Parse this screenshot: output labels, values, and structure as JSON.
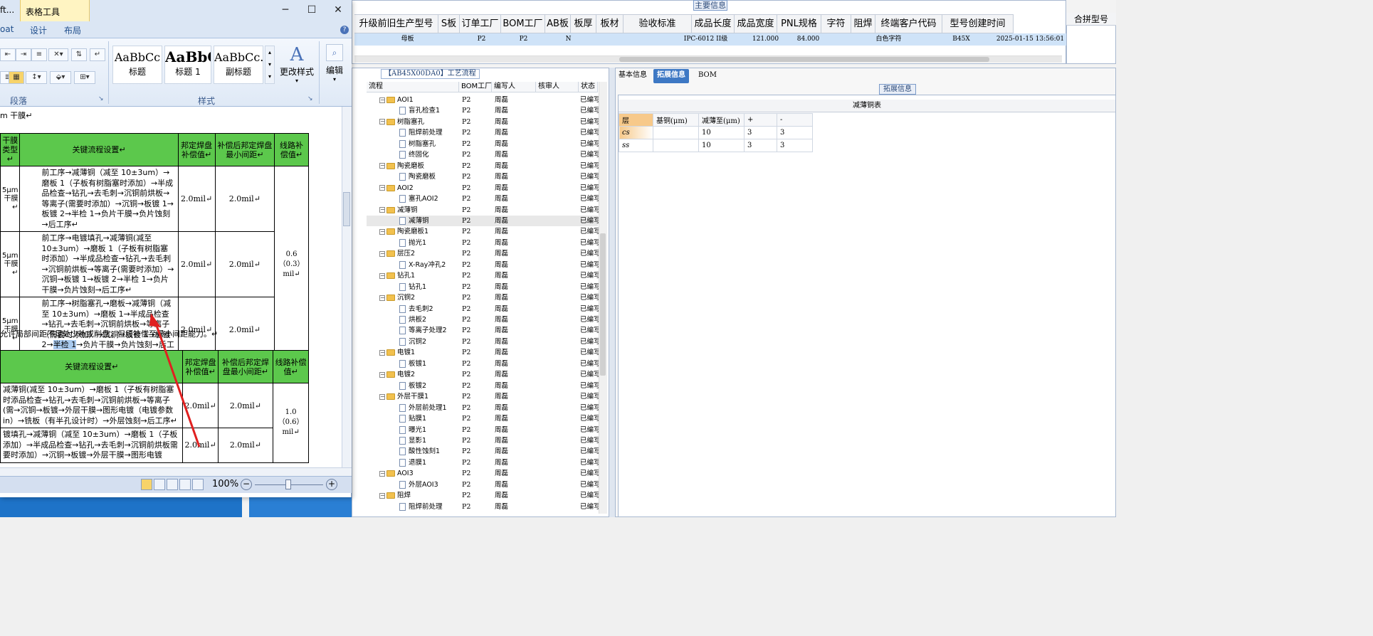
{
  "top_grid": {
    "section_label": "主要信息",
    "headers": [
      "升级前旧生产型号",
      "S板",
      "订单工厂",
      "BOM工厂",
      "AB板",
      "板厚",
      "板材",
      "验收标准",
      "成品长度",
      "成品宽度",
      "PNL规格",
      "字符",
      "阻焊",
      "终端客户代码",
      "型号创建时间"
    ],
    "row": [
      "母板",
      "P2",
      "P2",
      "N",
      "",
      "",
      "IPC-6012 II级",
      "121.000",
      "84.000",
      "",
      "白色字符",
      "",
      "B45X",
      "2025-01-15 13:56:01"
    ],
    "merge_header": "合拼型号"
  },
  "flow": {
    "title": "【AB45X00DA0】工艺流程",
    "headers": [
      "流程",
      "BOM工厂",
      "编写人",
      "核审人",
      "状态"
    ],
    "rows": [
      {
        "name": "AOI1",
        "type": "folder",
        "bom": "P2",
        "writer": "周磊",
        "status": "已编写"
      },
      {
        "name": "盲孔检查1",
        "type": "file",
        "bom": "P2",
        "writer": "周磊",
        "status": "已编写"
      },
      {
        "name": "树脂塞孔",
        "type": "folder",
        "bom": "P2",
        "writer": "周磊",
        "status": "已编写"
      },
      {
        "name": "阻焊前处理",
        "type": "file",
        "bom": "P2",
        "writer": "周磊",
        "status": "已编写"
      },
      {
        "name": "树脂塞孔",
        "type": "file",
        "bom": "P2",
        "writer": "周磊",
        "status": "已编写"
      },
      {
        "name": "终固化",
        "type": "file",
        "bom": "P2",
        "writer": "周磊",
        "status": "已编写"
      },
      {
        "name": "陶瓷磨板",
        "type": "folder",
        "bom": "P2",
        "writer": "周磊",
        "status": "已编写"
      },
      {
        "name": "陶瓷磨板",
        "type": "file",
        "bom": "P2",
        "writer": "周磊",
        "status": "已编写"
      },
      {
        "name": "AOI2",
        "type": "folder",
        "bom": "P2",
        "writer": "周磊",
        "status": "已编写"
      },
      {
        "name": "塞孔AOI2",
        "type": "file",
        "bom": "P2",
        "writer": "周磊",
        "status": "已编写"
      },
      {
        "name": "减薄铜",
        "type": "folder",
        "bom": "P2",
        "writer": "周磊",
        "status": "已编写"
      },
      {
        "name": "减薄铜",
        "type": "file",
        "bom": "P2",
        "writer": "周磊",
        "status": "已编写",
        "selected": true
      },
      {
        "name": "陶瓷磨板1",
        "type": "folder",
        "bom": "P2",
        "writer": "周磊",
        "status": "已编写"
      },
      {
        "name": "抛光1",
        "type": "file",
        "bom": "P2",
        "writer": "周磊",
        "status": "已编写"
      },
      {
        "name": "层压2",
        "type": "folder",
        "bom": "P2",
        "writer": "周磊",
        "status": "已编写"
      },
      {
        "name": "X-Ray冲孔2",
        "type": "file",
        "bom": "P2",
        "writer": "周磊",
        "status": "已编写"
      },
      {
        "name": "钻孔1",
        "type": "folder",
        "bom": "P2",
        "writer": "周磊",
        "status": "已编写"
      },
      {
        "name": "钻孔1",
        "type": "file",
        "bom": "P2",
        "writer": "周磊",
        "status": "已编写"
      },
      {
        "name": "沉铜2",
        "type": "folder",
        "bom": "P2",
        "writer": "周磊",
        "status": "已编写"
      },
      {
        "name": "去毛刺2",
        "type": "file",
        "bom": "P2",
        "writer": "周磊",
        "status": "已编写"
      },
      {
        "name": "烘板2",
        "type": "file",
        "bom": "P2",
        "writer": "周磊",
        "status": "已编写"
      },
      {
        "name": "等离子处理2",
        "type": "file",
        "bom": "P2",
        "writer": "周磊",
        "status": "已编写"
      },
      {
        "name": "沉铜2",
        "type": "file",
        "bom": "P2",
        "writer": "周磊",
        "status": "已编写"
      },
      {
        "name": "电镀1",
        "type": "folder",
        "bom": "P2",
        "writer": "周磊",
        "status": "已编写"
      },
      {
        "name": "板镀1",
        "type": "file",
        "bom": "P2",
        "writer": "周磊",
        "status": "已编写"
      },
      {
        "name": "电镀2",
        "type": "folder",
        "bom": "P2",
        "writer": "周磊",
        "status": "已编写"
      },
      {
        "name": "板镀2",
        "type": "file",
        "bom": "P2",
        "writer": "周磊",
        "status": "已编写"
      },
      {
        "name": "外层干膜1",
        "type": "folder",
        "bom": "P2",
        "writer": "周磊",
        "status": "已编写"
      },
      {
        "name": "外层前处理1",
        "type": "file",
        "bom": "P2",
        "writer": "周磊",
        "status": "已编写"
      },
      {
        "name": "贴膜1",
        "type": "file",
        "bom": "P2",
        "writer": "周磊",
        "status": "已编写"
      },
      {
        "name": "曝光1",
        "type": "file",
        "bom": "P2",
        "writer": "周磊",
        "status": "已编写"
      },
      {
        "name": "显影1",
        "type": "file",
        "bom": "P2",
        "writer": "周磊",
        "status": "已编写"
      },
      {
        "name": "酸性蚀刻1",
        "type": "file",
        "bom": "P2",
        "writer": "周磊",
        "status": "已编写"
      },
      {
        "name": "退膜1",
        "type": "file",
        "bom": "P2",
        "writer": "周磊",
        "status": "已编写"
      },
      {
        "name": "AOI3",
        "type": "folder",
        "bom": "P2",
        "writer": "周磊",
        "status": "已编写"
      },
      {
        "name": "外层AOI3",
        "type": "file",
        "bom": "P2",
        "writer": "周磊",
        "status": "已编写"
      },
      {
        "name": "阻焊",
        "type": "folder",
        "bom": "P2",
        "writer": "周磊",
        "status": "已编写"
      },
      {
        "name": "阻焊前处理",
        "type": "file",
        "bom": "P2",
        "writer": "周磊",
        "status": "已编写"
      }
    ]
  },
  "info": {
    "tabs": [
      "基本信息",
      "拓展信息",
      "BOM"
    ],
    "ext_label": "拓展信息",
    "table_title": "减薄铜表",
    "headers": [
      "层",
      "基铜(μm)",
      "减薄至(μm)",
      "+",
      "-"
    ],
    "rows": [
      [
        "cs",
        "",
        "10",
        "3",
        "3"
      ],
      [
        "ss",
        "",
        "10",
        "3",
        "3"
      ]
    ]
  },
  "word": {
    "title": "ft...",
    "context_tab": "表格工具",
    "tabs": [
      "oat",
      "设计",
      "布局"
    ],
    "styles": [
      {
        "sample": "AaBbCc",
        "name": "标题"
      },
      {
        "sample": "AaBbC",
        "name": "标题 1"
      },
      {
        "sample": "AaBbCc.",
        "name": "副标题"
      }
    ],
    "change_styles": "更改样式",
    "edit": "编辑",
    "group_paragraph": "段落",
    "group_styles": "样式",
    "doc_line1": "m 干膜↵",
    "table1": {
      "headers": [
        "干膜类型↵",
        "关键流程设置↵",
        "邦定焊盘补偿值↵",
        "补偿后邦定焊盘最小间距↵",
        "线路补偿值↵"
      ],
      "rows": [
        {
          "type": "5μm干膜↵",
          "proc": "前工序→减薄铜（减至 10±3um）→磨板 1（子板有树脂塞时添加）→半成品检查→钻孔→去毛刺→沉铜前烘板→等离子(需要时添加）→沉铜→板镀 1→板镀 2→半检 1→负片干膜→负片蚀刻→后工序↵",
          "comp": "2.0mil↵",
          "min": "2.0mil↵"
        },
        {
          "type": "5μm干膜↵",
          "proc": "前工序→电镀填孔→减薄铜(减至 10±3um）→磨板 1（子板有树脂塞时添加）→半成品检查→钻孔→去毛刺→沉铜前烘板→等离子(需要时添加）→沉铜→板镀 1→板镀 2→半检 1→负片干膜→负片蚀刻→后工序↵",
          "comp": "2.0mil↵",
          "min": "2.0mil↵"
        },
        {
          "type": "5μm干膜↵",
          "proc_a": "前工序→树脂塞孔→磨板→减薄铜（减至 10±3um）→磨板 1→半成品检查→钻孔→去毛刺→沉铜前烘板→等离子（需要时添加）→沉铜→板镀 1→板镀 2→",
          "proc_hl": "半检 1",
          "proc_b": "→负片干膜→负片蚀刻→后工序↵",
          "comp": "2.0mil↵",
          "min": "2.0mil↵"
        }
      ],
      "line_comp": "0.6（0.3）mil↵"
    },
    "note": "允许局部间距不足处少补或削盘，但须补偿至最小间距能力。↵",
    "table2": {
      "headers": [
        "关键流程设置↵",
        "邦定焊盘补偿值↵",
        "补偿后邦定焊盘最小间距↵",
        "线路补偿值↵"
      ],
      "rows": [
        {
          "proc": "减薄铜(减至 10±3um）→磨板 1（子板有树脂塞时添品检查→钻孔→去毛刺→沉铜前烘板→等离子(需→沉铜→板镀→外层干膜→图形电镀（电镀参数in）→铣板（有半孔设计时）→外层蚀刻→后工序↵",
          "comp": "2.0mil↵",
          "min": "2.0mil↵"
        },
        {
          "proc": "镀填孔→减薄铜（减至 10±3um）→磨板 1（子板添加）→半成品检查→钻孔→去毛刺→沉铜前烘板需要时添加）→沉铜→板镀→外层干膜→图形电镀",
          "comp": "2.0mil↵",
          "min": "2.0mil↵"
        }
      ],
      "line_comp": "1.0（0.6）mil↵"
    },
    "zoom": "100%"
  },
  "colors": {
    "table_header_green": "#5cc84c",
    "selected_tab": "#3d78c4",
    "highlight": "#a8c9ee",
    "arrow": "#e02020"
  }
}
